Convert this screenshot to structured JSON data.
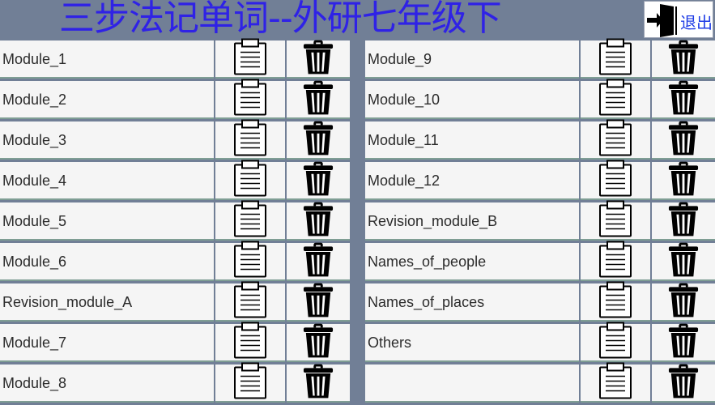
{
  "header": {
    "title": "三步法记单词--外研七年级下",
    "exit_label": "退出",
    "title_color": "#2f22e6"
  },
  "icons": {
    "exit": "exit-door-icon",
    "list": "clipboard-icon",
    "delete": "trash-icon"
  },
  "left_column": [
    {
      "name": "Module_1"
    },
    {
      "name": "Module_2"
    },
    {
      "name": "Module_3"
    },
    {
      "name": "Module_4"
    },
    {
      "name": "Module_5"
    },
    {
      "name": "Module_6"
    },
    {
      "name": "Revision_module_A"
    },
    {
      "name": "Module_7"
    },
    {
      "name": "Module_8"
    }
  ],
  "right_column": [
    {
      "name": "Module_9"
    },
    {
      "name": "Module_10"
    },
    {
      "name": "Module_11"
    },
    {
      "name": "Module_12"
    },
    {
      "name": "Revision_module_B"
    },
    {
      "name": "Names_of_people"
    },
    {
      "name": "Names_of_places"
    },
    {
      "name": "Others"
    },
    {
      "name": ""
    }
  ]
}
